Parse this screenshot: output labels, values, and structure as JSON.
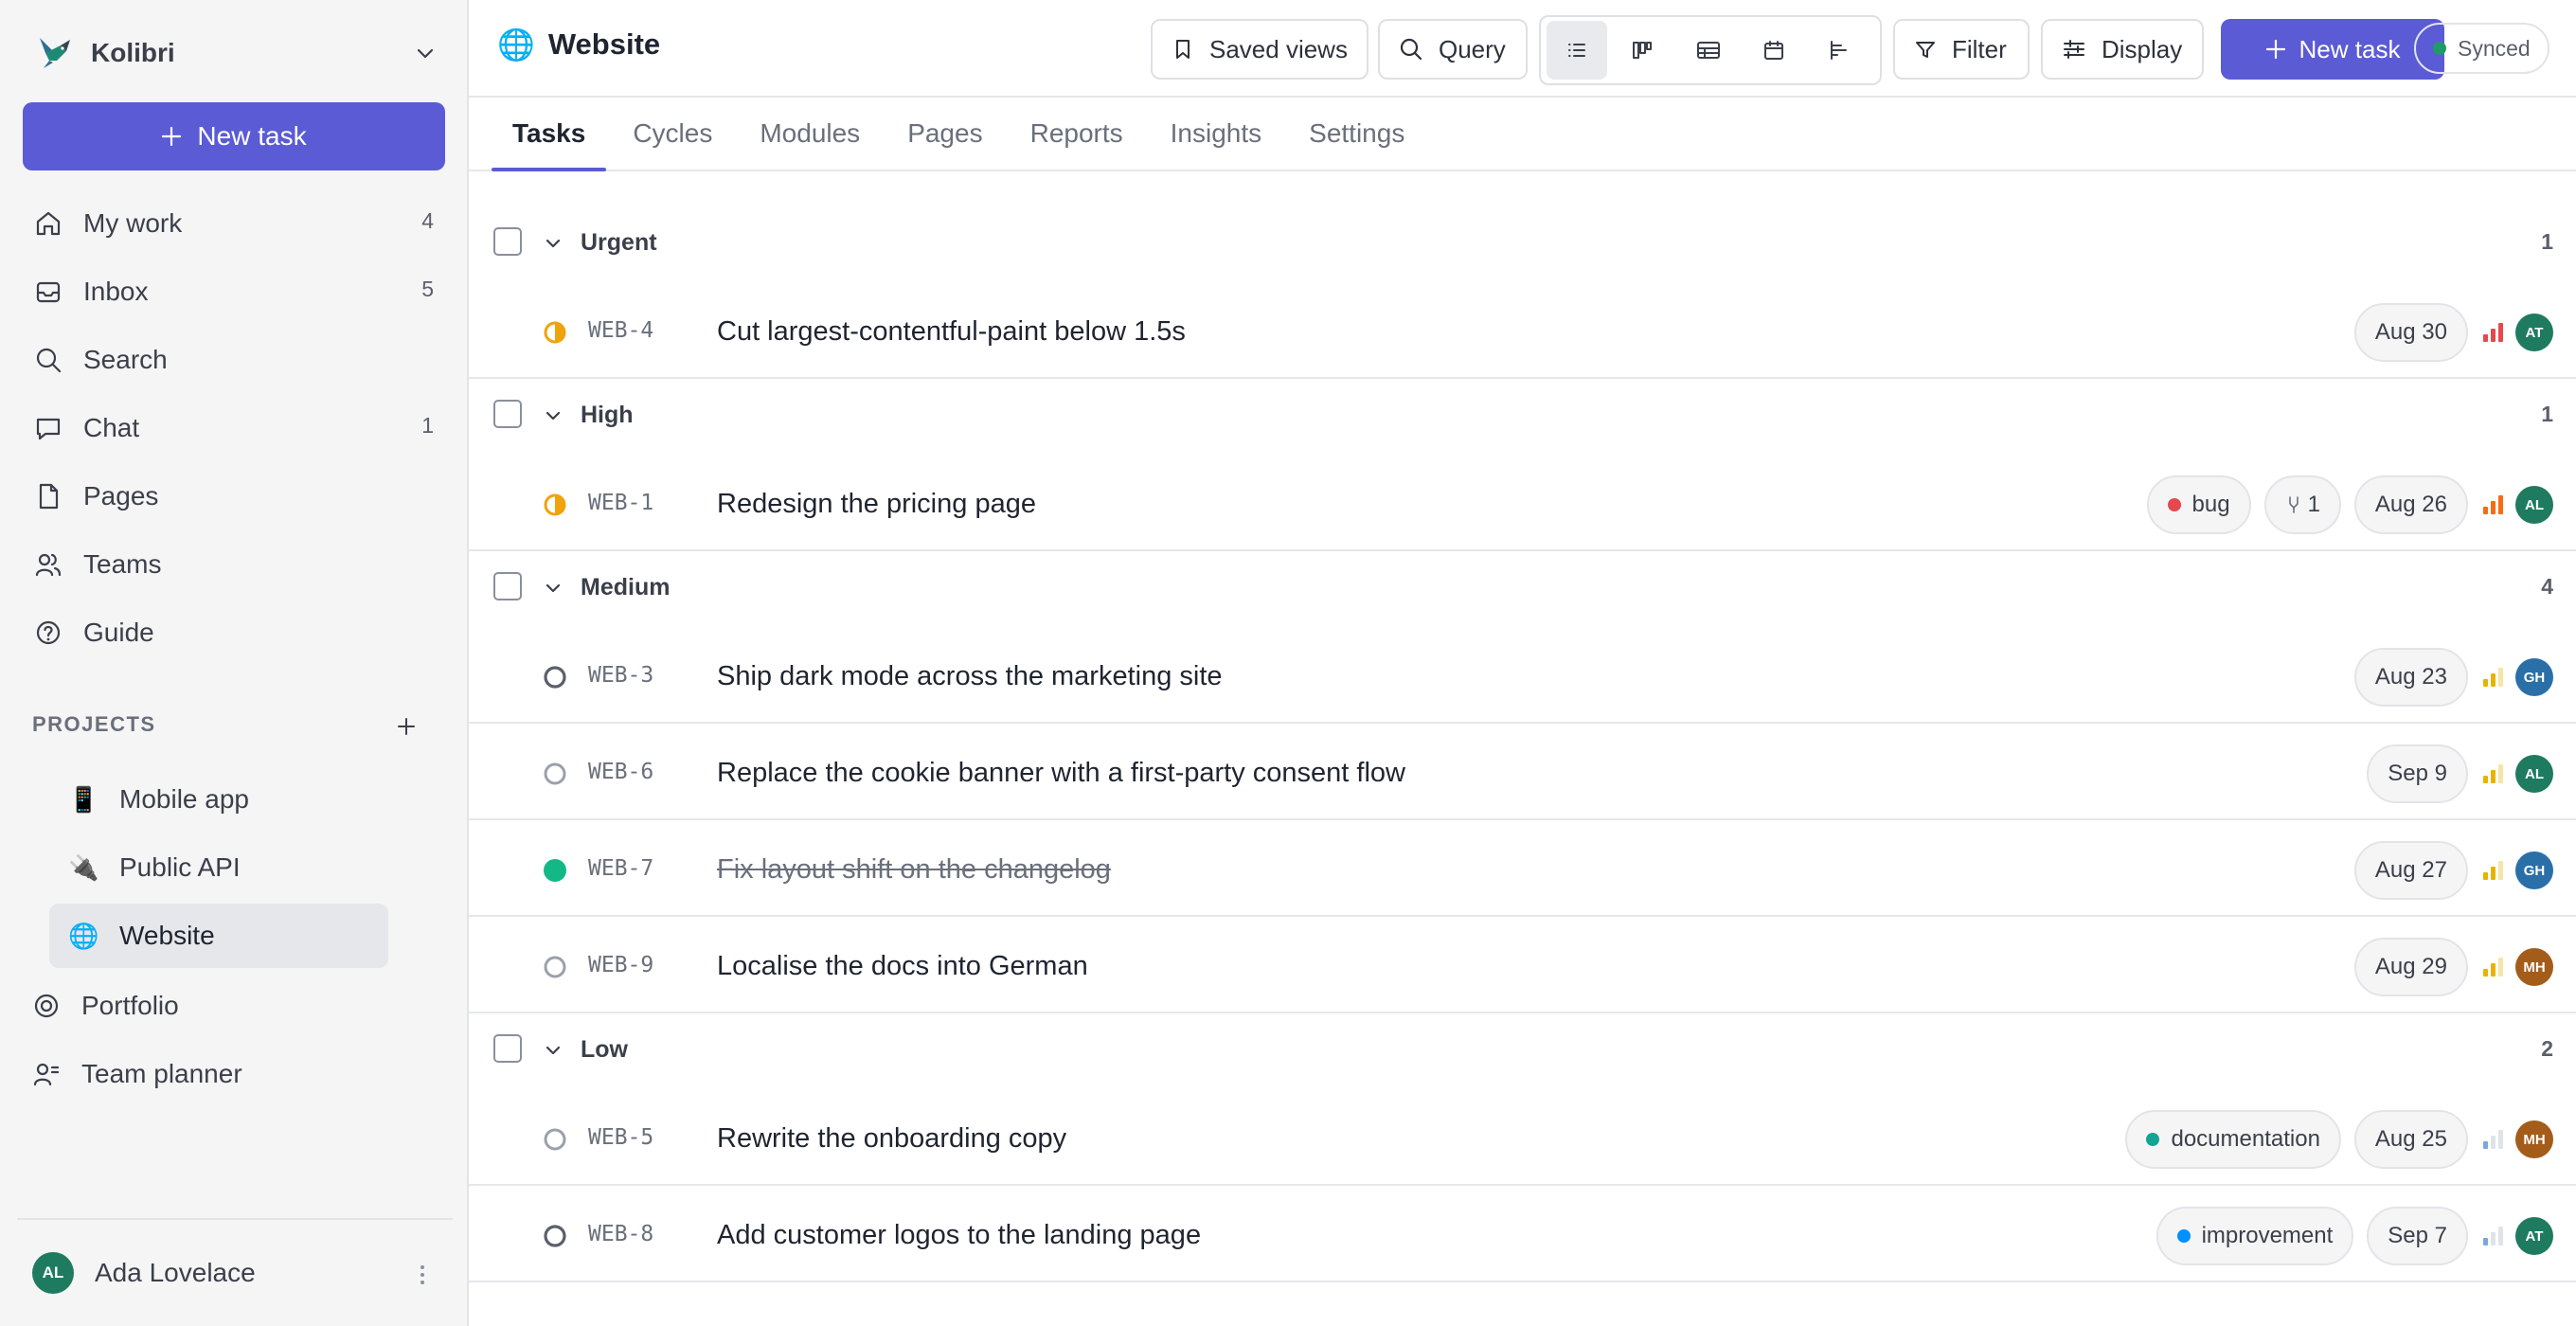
{
  "workspace": {
    "name": "Kolibri"
  },
  "sidebar": {
    "new_task": "New task",
    "nav": [
      {
        "label": "My work",
        "count": "4",
        "icon": "home-icon"
      },
      {
        "label": "Inbox",
        "count": "5",
        "icon": "inbox-icon"
      },
      {
        "label": "Search",
        "count": "",
        "icon": "search-icon"
      },
      {
        "label": "Chat",
        "count": "1",
        "icon": "chat-icon"
      },
      {
        "label": "Pages",
        "count": "",
        "icon": "page-icon"
      },
      {
        "label": "Teams",
        "count": "",
        "icon": "users-icon"
      },
      {
        "label": "Guide",
        "count": "",
        "icon": "help-icon"
      }
    ],
    "projects_heading": "PROJECTS",
    "projects": [
      {
        "emoji": "📱",
        "label": "Mobile app"
      },
      {
        "emoji": "🔌",
        "label": "Public API"
      },
      {
        "emoji": "🌐",
        "label": "Website",
        "active": true
      }
    ],
    "nav2": [
      {
        "label": "Portfolio",
        "icon": "portfolio-icon"
      },
      {
        "label": "Team planner",
        "icon": "team-planner-icon"
      }
    ],
    "user": {
      "initials": "AL",
      "name": "Ada Lovelace"
    }
  },
  "header": {
    "emoji": "🌐",
    "title": "Website",
    "saved_views": "Saved views",
    "query": "Query",
    "filter": "Filter",
    "display": "Display",
    "new_task": "New task",
    "sync_status": "Synced",
    "active_view": "list"
  },
  "tabs": [
    "Tasks",
    "Cycles",
    "Modules",
    "Pages",
    "Reports",
    "Insights",
    "Settings"
  ],
  "active_tab": "Tasks",
  "colors": {
    "accent": "#5b5bd6",
    "urgent": "#e5484d",
    "high": "#f76b15",
    "medium": "#e6b400",
    "low": "#7aa7e0"
  },
  "groups": [
    {
      "name": "Urgent",
      "count": "1",
      "tasks": [
        {
          "id": "WEB-4",
          "title": "Cut largest-contentful-paint below 1.5s",
          "status": "in-progress",
          "labels": [],
          "subtasks": "",
          "date": "Aug 30",
          "priority": "urgent",
          "assignee": "AT"
        }
      ]
    },
    {
      "name": "High",
      "count": "1",
      "tasks": [
        {
          "id": "WEB-1",
          "title": "Redesign the pricing page",
          "status": "in-progress",
          "labels": [
            {
              "name": "bug",
              "color": "#e5484d"
            }
          ],
          "subtasks": "1",
          "date": "Aug 26",
          "priority": "high",
          "assignee": "AL"
        }
      ]
    },
    {
      "name": "Medium",
      "count": "4",
      "tasks": [
        {
          "id": "WEB-3",
          "title": "Ship dark mode across the marketing site",
          "status": "todo",
          "labels": [],
          "subtasks": "",
          "date": "Aug 23",
          "priority": "medium",
          "assignee": "GH"
        },
        {
          "id": "WEB-6",
          "title": "Replace the cookie banner with a first-party consent flow",
          "status": "backlog",
          "labels": [],
          "subtasks": "",
          "date": "Sep 9",
          "priority": "medium",
          "assignee": "AL"
        },
        {
          "id": "WEB-7",
          "title": "Fix layout shift on the changelog",
          "status": "done",
          "labels": [],
          "subtasks": "",
          "date": "Aug 27",
          "priority": "medium",
          "assignee": "GH"
        },
        {
          "id": "WEB-9",
          "title": "Localise the docs into German",
          "status": "backlog",
          "labels": [],
          "subtasks": "",
          "date": "Aug 29",
          "priority": "medium",
          "assignee": "MH"
        }
      ]
    },
    {
      "name": "Low",
      "count": "2",
      "tasks": [
        {
          "id": "WEB-5",
          "title": "Rewrite the onboarding copy",
          "status": "backlog",
          "labels": [
            {
              "name": "documentation",
              "color": "#12a594"
            }
          ],
          "subtasks": "",
          "date": "Aug 25",
          "priority": "low",
          "assignee": "MH"
        },
        {
          "id": "WEB-8",
          "title": "Add customer logos to the landing page",
          "status": "todo",
          "labels": [
            {
              "name": "improvement",
              "color": "#0090ff"
            }
          ],
          "subtasks": "",
          "date": "Sep 7",
          "priority": "low",
          "assignee": "AT"
        }
      ]
    }
  ]
}
